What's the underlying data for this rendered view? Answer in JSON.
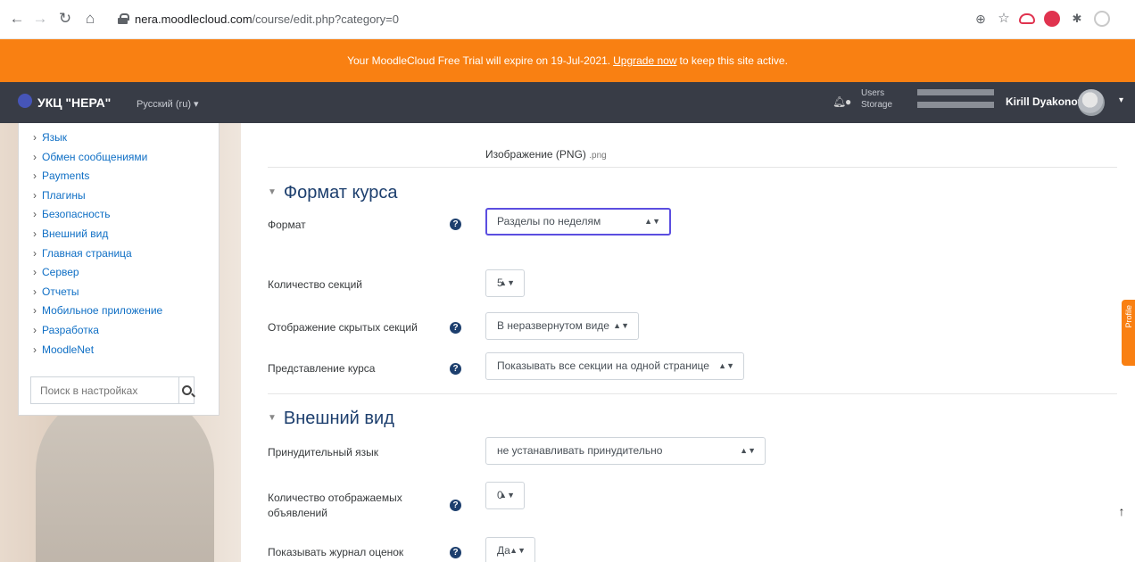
{
  "browser": {
    "url_host": "nera.moodlecloud.com",
    "url_path": "/course/edit.php?category=0"
  },
  "banner": {
    "text_before": "Your MoodleCloud Free Trial will expire on 19-Jul-2021.",
    "link": "Upgrade now",
    "text_after": "to keep this site active."
  },
  "navbar": {
    "site_name": "УКЦ \"НЕРА\"",
    "language": "Русский (ru) ▾",
    "usage_users_label": "Users",
    "usage_storage_label": "Storage",
    "user_name": "Kirill Dyakonov"
  },
  "sidebar": {
    "items": [
      {
        "label": "Язык"
      },
      {
        "label": "Обмен сообщениями"
      },
      {
        "label": "Payments"
      },
      {
        "label": "Плагины"
      },
      {
        "label": "Безопасность"
      },
      {
        "label": "Внешний вид"
      },
      {
        "label": "Главная страница"
      },
      {
        "label": "Сервер"
      },
      {
        "label": "Отчеты"
      },
      {
        "label": "Мобильное приложение"
      },
      {
        "label": "Разработка"
      },
      {
        "label": "MoodleNet"
      }
    ],
    "search_placeholder": "Поиск в настройках"
  },
  "form": {
    "top_file_type": "Изображение (PNG)",
    "top_file_ext": ".png",
    "section_format": {
      "title": "Формат курса",
      "format_label": "Формат",
      "format_value": "Разделы по неделям",
      "sections_label": "Количество секций",
      "sections_value": "5",
      "hidden_label": "Отображение скрытых секций",
      "hidden_value": "В неразвернутом виде",
      "layout_label": "Представление курса",
      "layout_value": "Показывать все секции на одной странице"
    },
    "section_appearance": {
      "title": "Внешний вид",
      "lang_label": "Принудительный язык",
      "lang_value": "не устанавливать принудительно",
      "news_label_1": "Количество отображаемых",
      "news_label_2": "объявлений",
      "news_value": "0",
      "grades_label": "Показывать журнал оценок",
      "grades_value": "Да"
    }
  },
  "side_tab": "Profile"
}
